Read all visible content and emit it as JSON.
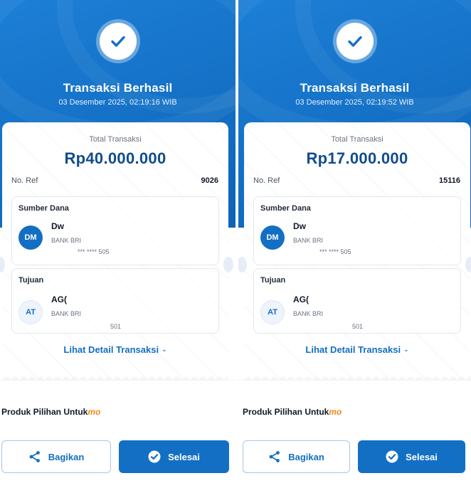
{
  "panels": [
    {
      "title": "Transaksi Berhasil",
      "datetime": "03 Desember 2025, 02:19:16 WIB",
      "total_label": "Total Transaksi",
      "total_amount": "Rp40.000.000",
      "ref_label": "No. Ref",
      "ref_value": "9026",
      "source_label": "Sumber Dana",
      "source_initials": "DM",
      "source_name": "Dw",
      "source_bank": "BANK BRI",
      "source_account": "*** **** 505",
      "dest_label": "Tujuan",
      "dest_initials": "AT",
      "dest_name": "AG(",
      "dest_bank": "BANK BRI",
      "dest_account": "501",
      "detail_link": "Lihat Detail Transaksi",
      "produk_text": "Produk Pilihan Untuk",
      "produk_brand": "mo",
      "share_label": "Bagikan",
      "done_label": "Selesai"
    },
    {
      "title": "Transaksi Berhasil",
      "datetime": "03 Desember 2025, 02:19:52 WIB",
      "total_label": "Total Transaksi",
      "total_amount": "Rp17.000.000",
      "ref_label": "No. Ref",
      "ref_value": "15116",
      "source_label": "Sumber Dana",
      "source_initials": "DM",
      "source_name": "Dw",
      "source_bank": "BANK BRI",
      "source_account": "*** **** 505",
      "dest_label": "Tujuan",
      "dest_initials": "AT",
      "dest_name": "AG(",
      "dest_bank": "BANK BRI",
      "dest_account": "501",
      "detail_link": "Lihat Detail Transaksi",
      "produk_text": "Produk Pilihan Untuk",
      "produk_brand": "mo",
      "share_label": "Bagikan",
      "done_label": "Selesai"
    }
  ],
  "colors": {
    "primary": "#136fc4",
    "amount": "#0f4c8c",
    "brand_accent": "#f08a1b"
  },
  "icons": [
    "check-icon",
    "share-icon",
    "check-circle-icon",
    "chevron-down-icon"
  ]
}
